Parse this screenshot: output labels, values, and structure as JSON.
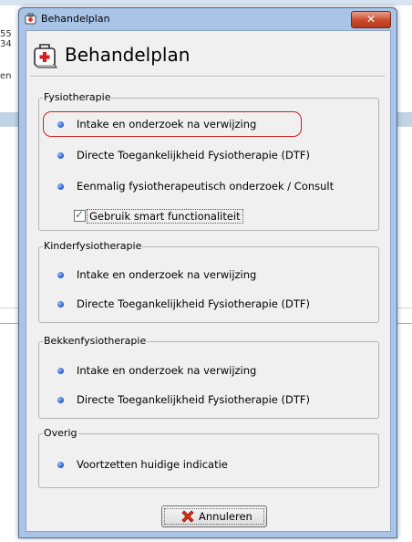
{
  "background": {
    "fragments": [
      "55",
      "34",
      "en"
    ]
  },
  "window": {
    "title": "Behandelplan",
    "close_label": "✕"
  },
  "header": {
    "title": "Behandelplan"
  },
  "groups": [
    {
      "label": "Fysiotherapie",
      "options": [
        {
          "label": "Intake en onderzoek na verwijzing",
          "highlighted": true
        },
        {
          "label": "Directe Toegankelijkheid Fysiotherapie (DTF)"
        },
        {
          "label": "Eenmalig fysiotherapeutisch onderzoek / Consult"
        }
      ],
      "checkbox": {
        "label": "Gebruik smart functionaliteit",
        "checked": true
      }
    },
    {
      "label": "Kinderfysiotherapie",
      "options": [
        {
          "label": "Intake en onderzoek na verwijzing"
        },
        {
          "label": "Directe Toegankelijkheid Fysiotherapie (DTF)"
        }
      ]
    },
    {
      "label": "Bekkenfysiotherapie",
      "options": [
        {
          "label": "Intake en onderzoek na verwijzing"
        },
        {
          "label": "Directe Toegankelijkheid Fysiotherapie (DTF)"
        }
      ]
    },
    {
      "label": "Overig",
      "options": [
        {
          "label": "Voortzetten huidige indicatie"
        }
      ]
    }
  ],
  "footer": {
    "cancel_label": "Annuleren"
  },
  "colors": {
    "highlight": "#d31d1d",
    "bullet": "#1f56c8",
    "close_button": "#c94a2c",
    "title_bar": "#a9c4e6"
  },
  "icons": {
    "window": "first-aid-kit-icon",
    "header": "first-aid-kit-icon",
    "bullet": "blue-dot-icon",
    "cancel": "red-x-icon"
  }
}
